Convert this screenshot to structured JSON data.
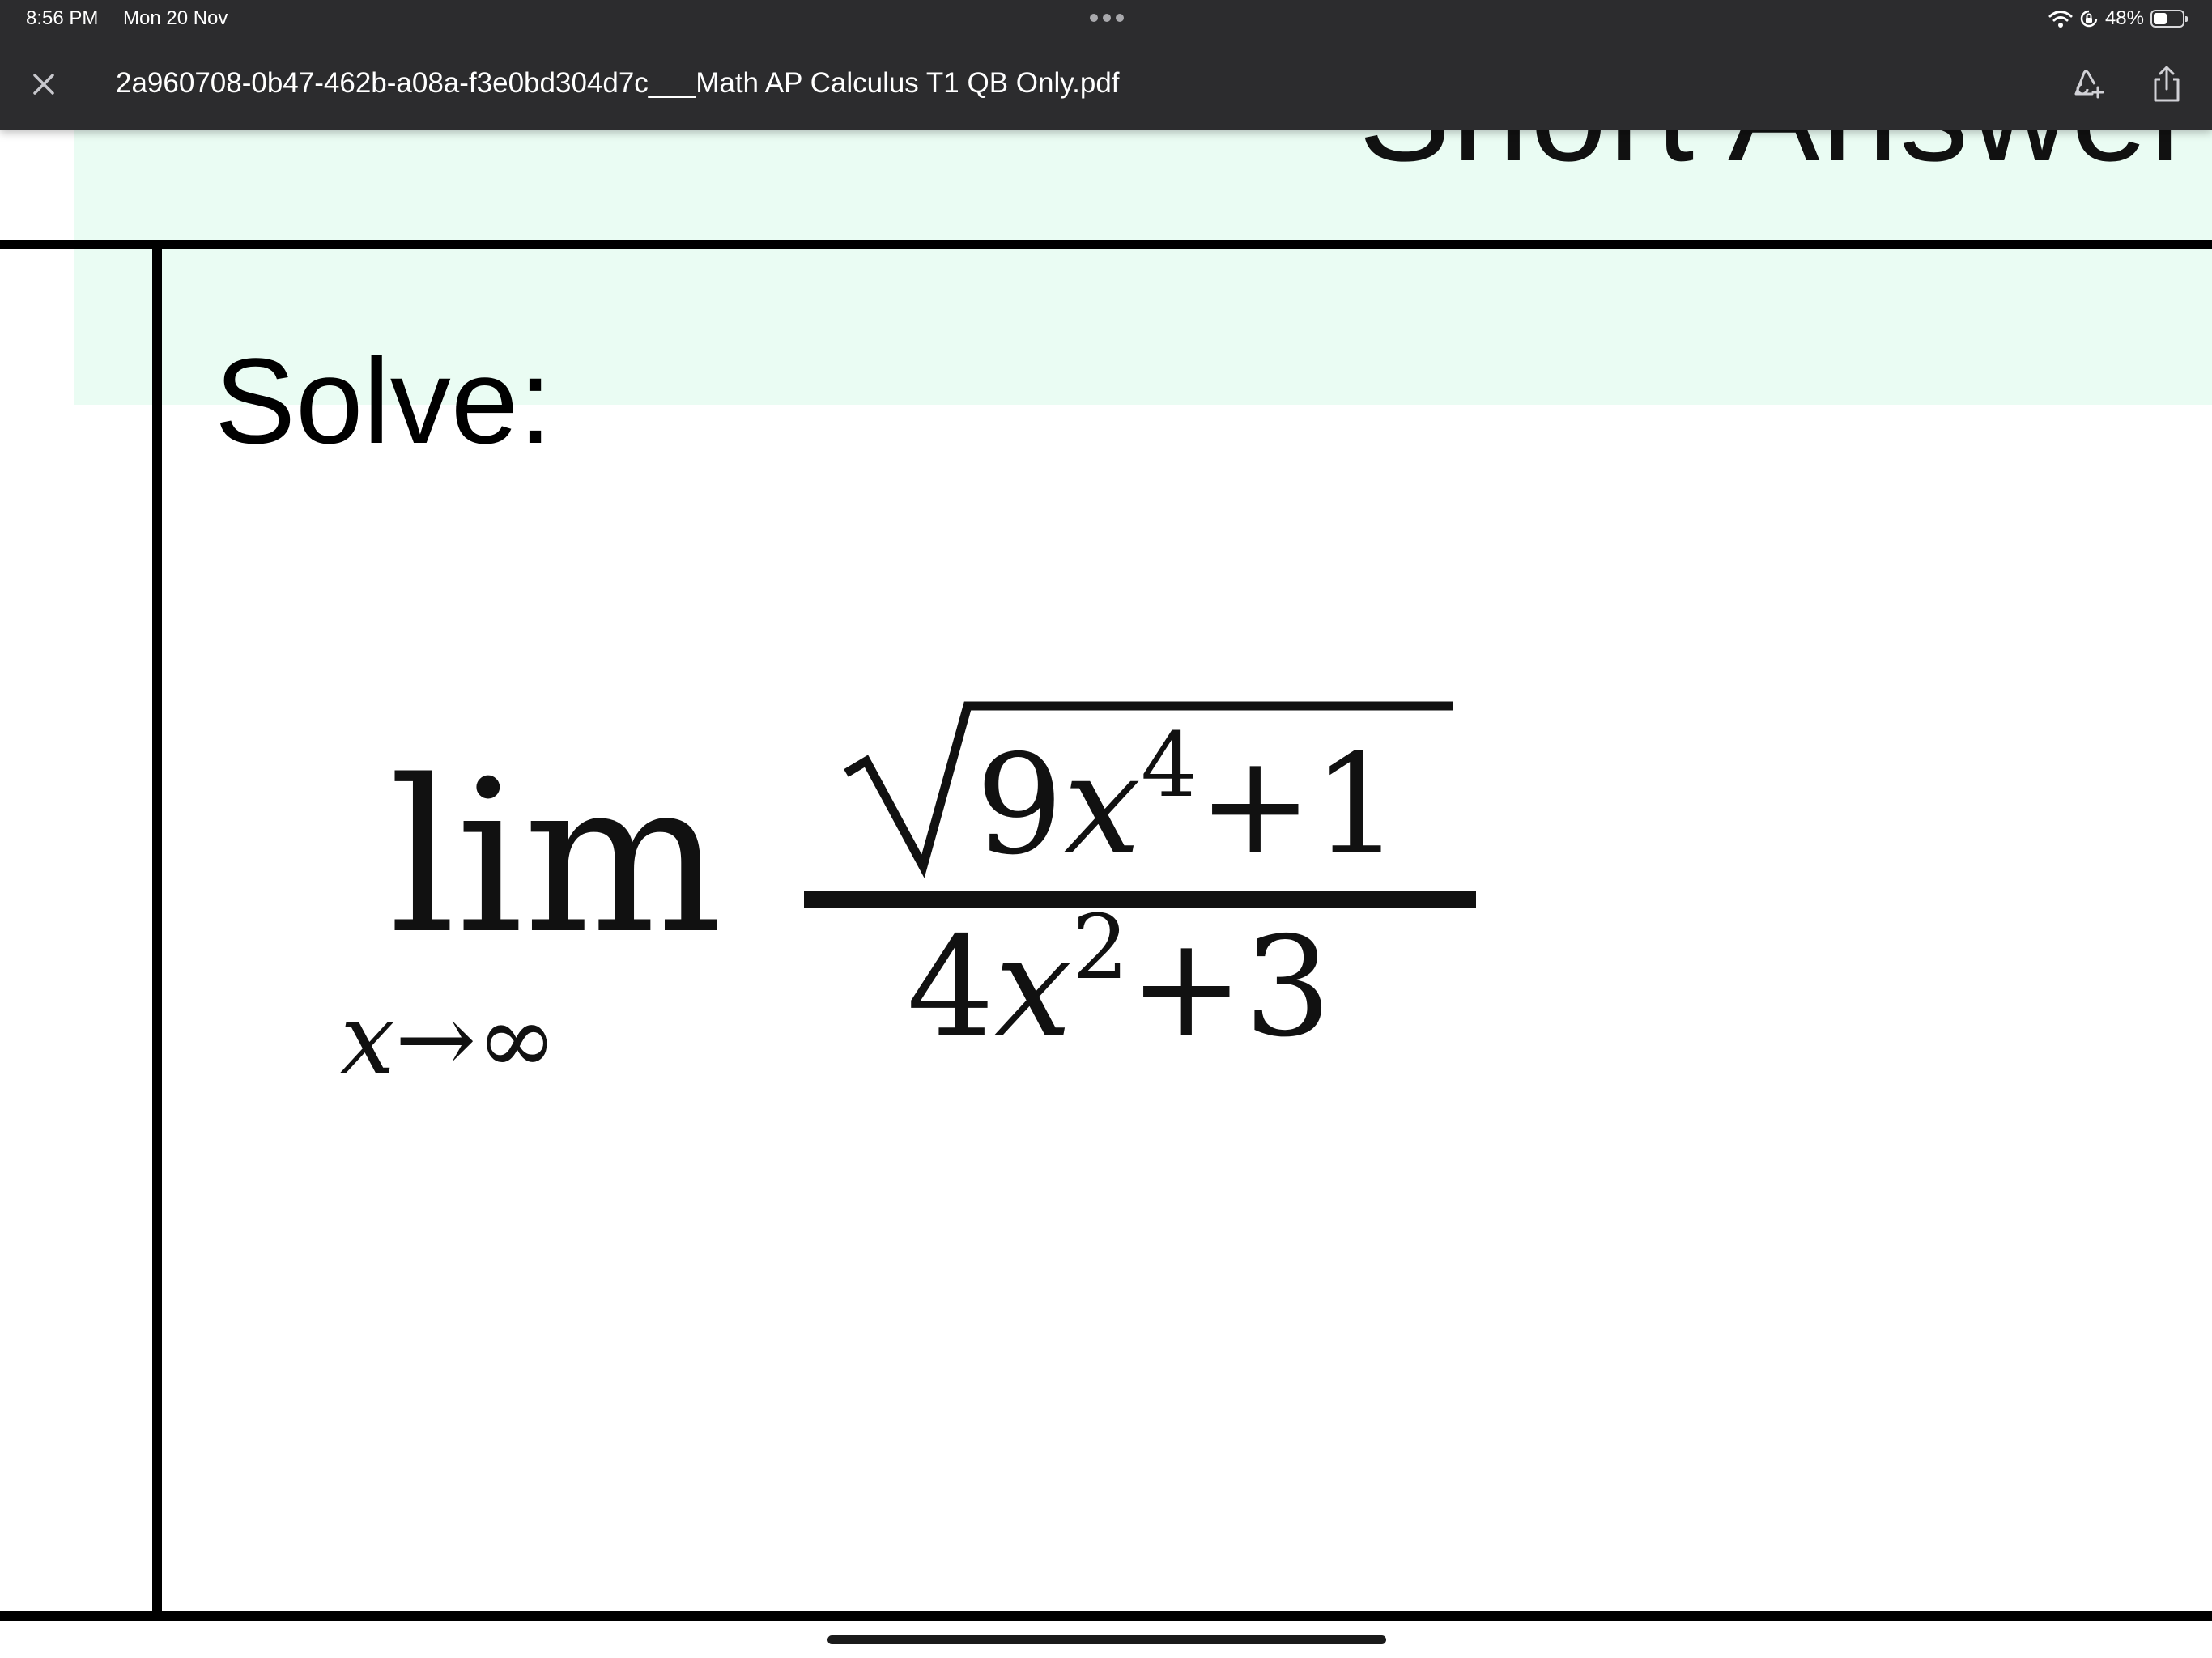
{
  "status_bar": {
    "time": "8:56 PM",
    "date": "Mon 20 Nov",
    "battery_percent": "48%",
    "battery_level": 0.48
  },
  "toolbar": {
    "close_icon": "close-icon",
    "document_title": "2a960708-0b47-462b-a08a-f3e0bd304d7c___Math AP Calculus T1 QB Only.pdf",
    "markup_icon": "markup-icon",
    "share_icon": "share-icon"
  },
  "document": {
    "section_heading": "Short Answer Qu",
    "prompt": "Solve:",
    "math": {
      "lim": "lim",
      "sub_var": "x",
      "sub_arrow": "→",
      "sub_limit": "∞",
      "num_coef": "9",
      "num_var": "x",
      "num_exp": "4",
      "num_rest": "+1",
      "den_coef": "4",
      "den_var": "x",
      "den_exp": "2",
      "den_rest": "+3"
    }
  },
  "colors": {
    "chrome_background": "#2c2c2e",
    "band_background": "#eafcf3",
    "rule_color": "#000000"
  }
}
